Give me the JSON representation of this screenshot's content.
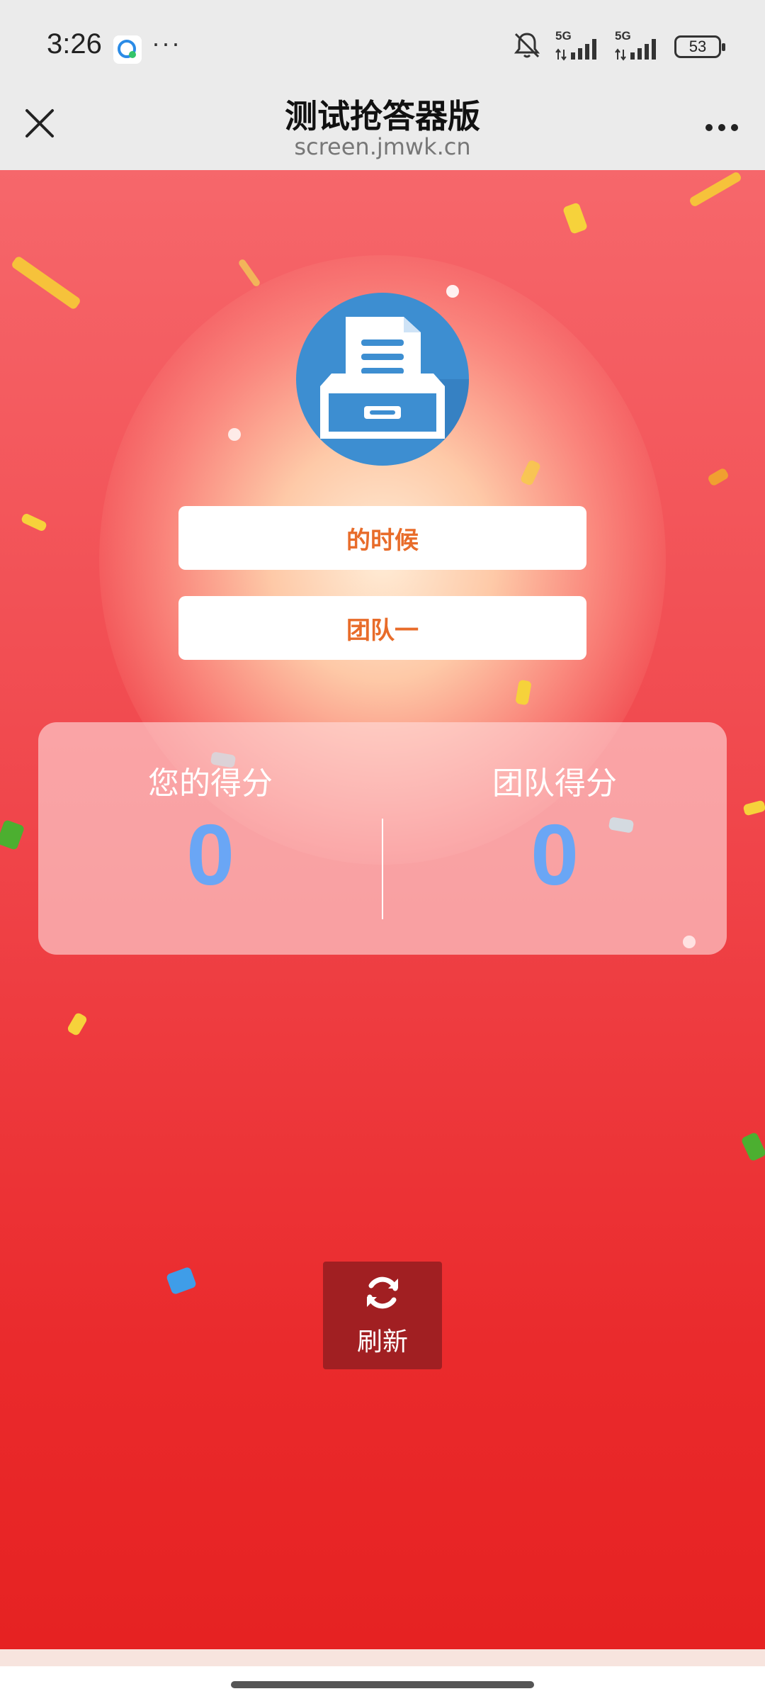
{
  "status_bar": {
    "time": "3:26",
    "more_indicator": "···",
    "signal_1_label": "5G",
    "signal_2_label": "5G",
    "battery": "53",
    "icons": [
      "app-notification-icon",
      "mute-icon",
      "signal-icon",
      "signal-icon",
      "battery-icon"
    ]
  },
  "nav": {
    "title": "测试抢答器版",
    "url": "screen.jmwk.cn",
    "close_icon": "close-icon",
    "more_icon": "more-icon"
  },
  "main": {
    "logo_icon": "file-cabinet-icon",
    "name_pill": "的时候",
    "team_pill": "团队一",
    "score": {
      "yours_label": "您的得分",
      "yours_value": "0",
      "team_label": "团队得分",
      "team_value": "0"
    },
    "refresh": {
      "label": "刷新",
      "icon": "refresh-icon"
    }
  },
  "colors": {
    "background_top": "#f6676b",
    "background_bottom": "#e62222",
    "pill_text": "#e86c2a",
    "score_value": "#6aa6f5",
    "refresh_button": "#a11f22",
    "logo_circle": "#3d8ed1"
  }
}
